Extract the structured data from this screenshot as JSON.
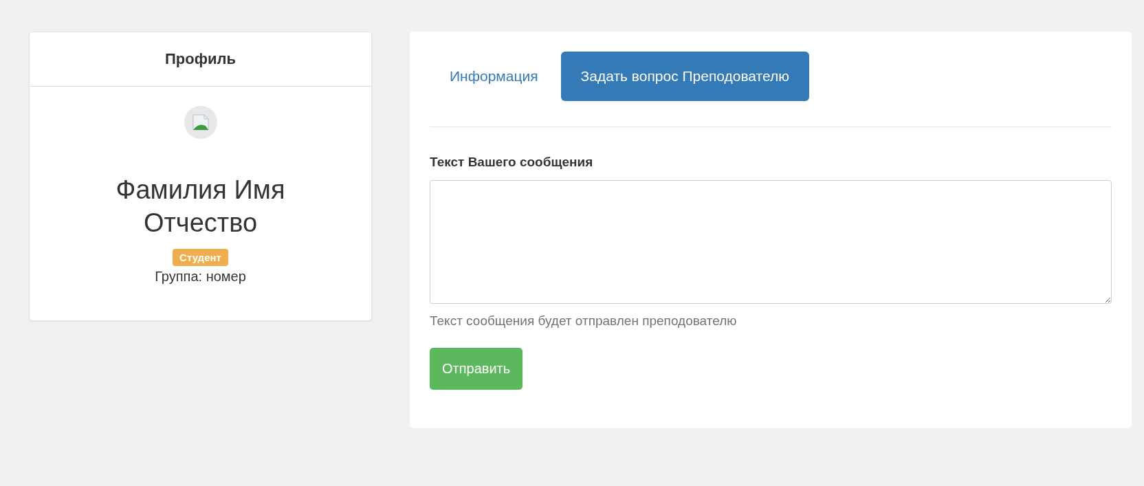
{
  "profile": {
    "title": "Профиль",
    "name": "Фамилия Имя Отчество",
    "role_badge": "Студент",
    "group": "Группа: номер"
  },
  "tabs": [
    {
      "label": "Информация",
      "selected": false
    },
    {
      "label": "Задать вопрос Преподователю",
      "selected": true
    }
  ],
  "form": {
    "label": "Текст Вашего сообщения",
    "help": "Текст сообщения будет отправлен преподователю",
    "submit": "Отправить"
  }
}
